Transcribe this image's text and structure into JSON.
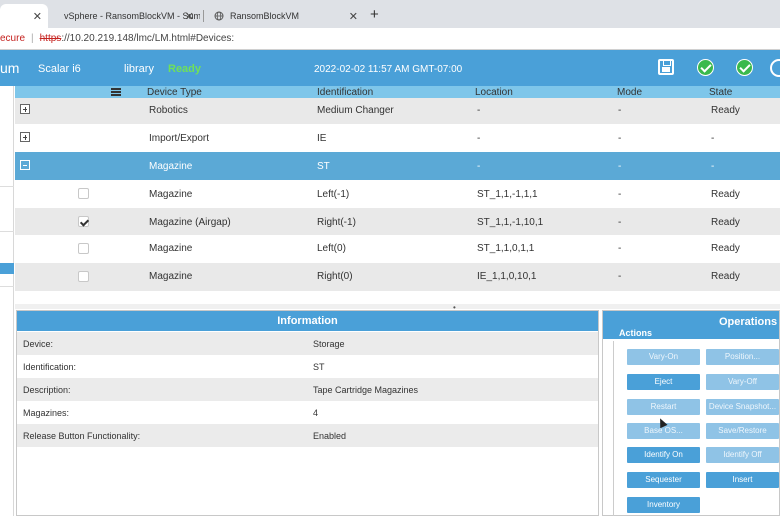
{
  "browser": {
    "tabs": [
      {
        "title": "",
        "active": true
      },
      {
        "title": "vSphere - RansomBlockVM - Sum",
        "active": false
      },
      {
        "title": "RansomBlockVM",
        "active": false
      }
    ],
    "address": {
      "secure_label": "ecure",
      "scheme": "https",
      "url_rest": "://10.20.219.148/lmc/LM.html#Devices:"
    }
  },
  "header": {
    "brand": "um",
    "model": "Scalar i6",
    "library_label": "library",
    "library_status": "Ready",
    "datetime": "2022-02-02 11:57 AM GMT-07:00",
    "status_color": "#3ab94c"
  },
  "table": {
    "columns": [
      "Device Type",
      "Identification",
      "Location",
      "Mode",
      "State"
    ],
    "rows": [
      {
        "expander": "plus",
        "type": "Robotics",
        "id": "Medium Changer",
        "location": "-",
        "mode": "-",
        "state": "Ready"
      },
      {
        "expander": "plus",
        "type": "Import/Export",
        "id": "IE",
        "location": "-",
        "mode": "-",
        "state": "-"
      },
      {
        "expander": "minus",
        "type": "Magazine",
        "id": "ST",
        "location": "-",
        "mode": "-",
        "state": "-"
      },
      {
        "checkbox": false,
        "type": "Magazine",
        "id": "Left(-1)",
        "location": "ST_1,1,-1,1,1",
        "mode": "-",
        "state": "Ready"
      },
      {
        "checkbox": true,
        "type": "Magazine (Airgap)",
        "id": "Right(-1)",
        "location": "ST_1,1,-1,10,1",
        "mode": "-",
        "state": "Ready"
      },
      {
        "checkbox": false,
        "type": "Magazine",
        "id": "Left(0)",
        "location": "ST_1,1,0,1,1",
        "mode": "-",
        "state": "Ready"
      },
      {
        "checkbox": false,
        "type": "Magazine",
        "id": "Right(0)",
        "location": "IE_1,1,0,10,1",
        "mode": "-",
        "state": "Ready"
      }
    ]
  },
  "information": {
    "title": "Information",
    "rows": [
      {
        "key": "Device:",
        "value": "Storage"
      },
      {
        "key": "Identification:",
        "value": "ST"
      },
      {
        "key": "Description:",
        "value": "Tape Cartridge Magazines"
      },
      {
        "key": "Magazines:",
        "value": "4"
      },
      {
        "key": "Release Button Functionality:",
        "value": "Enabled"
      }
    ]
  },
  "operations": {
    "title": "Operations",
    "actions_label": "Actions",
    "buttons": [
      {
        "label": "Vary-On",
        "enabled": false
      },
      {
        "label": "Position...",
        "enabled": false
      },
      {
        "label": "Eject",
        "enabled": true
      },
      {
        "label": "Vary-Off",
        "enabled": false
      },
      {
        "label": "Restart",
        "enabled": false
      },
      {
        "label": "Device Snapshot...",
        "enabled": false
      },
      {
        "label": "Base OS...",
        "enabled": false
      },
      {
        "label": "Save/Restore",
        "enabled": false
      },
      {
        "label": "Identify On",
        "enabled": true
      },
      {
        "label": "Identify Off",
        "enabled": false
      },
      {
        "label": "Sequester",
        "enabled": true
      },
      {
        "label": "Insert",
        "enabled": true
      },
      {
        "label": "Inventory",
        "enabled": true
      }
    ]
  }
}
